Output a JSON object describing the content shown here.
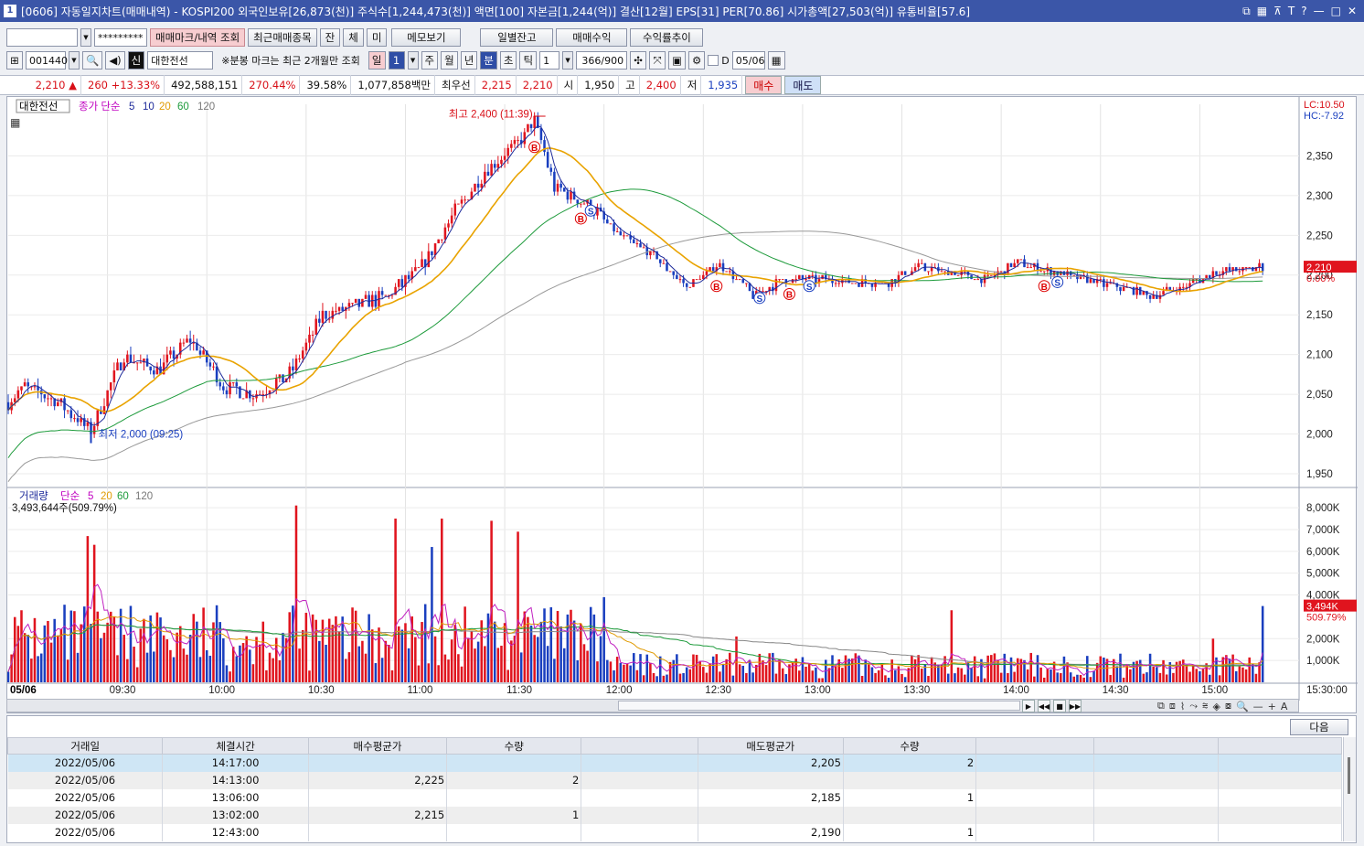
{
  "window": {
    "number": "1",
    "title": "[0606] 자동일지차트(매매내역) - KOSPI200 외국인보유[26,873(천)] 주식수[1,244,473(천)] 액면[100] 자본금[1,244(억)] 결산[12월] EPS[31] PER[70.86] 시가총액[27,503(억)] 유통비율[57.6]",
    "icons": [
      "restore-layout-icon",
      "window-grid-icon",
      "pin-icon",
      "text-icon",
      "help-icon",
      "minimize-icon",
      "maximize-icon",
      "close-icon"
    ]
  },
  "toolbar1": {
    "account_value": "",
    "password_value": "*********",
    "buttons": [
      "매매마크/내역 조회",
      "최근매매종목",
      "잔",
      "체",
      "미",
      "메모보기",
      "일별잔고",
      "매매수익",
      "수익률추이"
    ]
  },
  "toolbar2": {
    "code": "001440",
    "badge": "신",
    "stock_name": "대한전선",
    "notice": "※분봉 마크는 최근 2개월만 조회",
    "period_tabs": [
      "일",
      "1",
      "주",
      "월",
      "년",
      "분",
      "초",
      "틱"
    ],
    "interval": "1",
    "count": "366/900",
    "d_label": "D",
    "date": "05/06"
  },
  "quote": {
    "price": "2,210",
    "change": "260",
    "change_pct": "+13.33%",
    "volume": "492,588,151",
    "volume_ratio": "270.44%",
    "turnover": "39.58%",
    "amount": "1,077,858백만",
    "best_label": "최우선",
    "best_ask": "2,215",
    "best_bid": "2,210",
    "open_label": "시",
    "open": "1,950",
    "high_label": "고",
    "high": "2,400",
    "low_label": "저",
    "low": "1,935",
    "buy": "매수",
    "sell": "매도"
  },
  "chart_data": {
    "type": "candlestick",
    "price_legend": {
      "name": "대한전선",
      "label": "종가 단순",
      "periods": [
        "5",
        "10",
        "20",
        "60",
        "120"
      ]
    },
    "volume_legend": {
      "name": "거래량",
      "label": "단순",
      "periods": [
        "5",
        "20",
        "60",
        "120"
      ],
      "summary": "3,493,644주(509.79%)"
    },
    "lc": "LC:10.50",
    "hc": "HC:-7.92",
    "high_annotation": "최고 2,400 (11:39)",
    "low_annotation": "최저 2,000 (09:25)",
    "price_ticks": [
      "2,350",
      "2,300",
      "2,250",
      "2,200",
      "2,150",
      "2,100",
      "2,050",
      "2,000",
      "1,950"
    ],
    "price_ylim": [
      1935,
      2415
    ],
    "current_price": "2,210",
    "current_pct": "0.00%",
    "volume_ticks": [
      "8,000K",
      "7,000K",
      "6,000K",
      "5,000K",
      "4,000K",
      "2,000K",
      "1,000K"
    ],
    "volume_current": "3,494K",
    "volume_pct": "509.79%",
    "x_labels": [
      "05/06",
      "09:30",
      "10:00",
      "10:30",
      "11:00",
      "11:30",
      "12:00",
      "12:30",
      "13:00",
      "13:30",
      "14:00",
      "14:30",
      "15:00",
      "15:30:00"
    ],
    "price_path_keypoints": [
      {
        "time": "09:00",
        "price": 2040
      },
      {
        "time": "09:05",
        "price": 2060
      },
      {
        "time": "09:15",
        "price": 2040
      },
      {
        "time": "09:25",
        "price": 2005
      },
      {
        "time": "09:35",
        "price": 2100
      },
      {
        "time": "09:45",
        "price": 2080
      },
      {
        "time": "09:55",
        "price": 2120
      },
      {
        "time": "10:05",
        "price": 2060
      },
      {
        "time": "10:15",
        "price": 2050
      },
      {
        "time": "10:25",
        "price": 2075
      },
      {
        "time": "10:35",
        "price": 2150
      },
      {
        "time": "10:45",
        "price": 2160
      },
      {
        "time": "10:55",
        "price": 2175
      },
      {
        "time": "11:05",
        "price": 2210
      },
      {
        "time": "11:15",
        "price": 2280
      },
      {
        "time": "11:25",
        "price": 2335
      },
      {
        "time": "11:35",
        "price": 2370
      },
      {
        "time": "11:39",
        "price": 2395
      },
      {
        "time": "11:45",
        "price": 2310
      },
      {
        "time": "11:55",
        "price": 2290
      },
      {
        "time": "12:05",
        "price": 2250
      },
      {
        "time": "12:15",
        "price": 2225
      },
      {
        "time": "12:25",
        "price": 2185
      },
      {
        "time": "12:35",
        "price": 2215
      },
      {
        "time": "12:45",
        "price": 2175
      },
      {
        "time": "12:55",
        "price": 2195
      },
      {
        "time": "13:05",
        "price": 2195
      },
      {
        "time": "13:25",
        "price": 2190
      },
      {
        "time": "13:35",
        "price": 2210
      },
      {
        "time": "13:55",
        "price": 2195
      },
      {
        "time": "14:05",
        "price": 2215
      },
      {
        "time": "14:15",
        "price": 2205
      },
      {
        "time": "14:30",
        "price": 2190
      },
      {
        "time": "14:45",
        "price": 2175
      },
      {
        "time": "14:55",
        "price": 2185
      },
      {
        "time": "15:05",
        "price": 2205
      },
      {
        "time": "15:19",
        "price": 2210
      }
    ],
    "trade_marks": [
      {
        "type": "B",
        "time": "11:39"
      },
      {
        "type": "B",
        "time": "11:53"
      },
      {
        "type": "S",
        "time": "11:56"
      },
      {
        "type": "B",
        "time": "12:34"
      },
      {
        "type": "S",
        "time": "12:47"
      },
      {
        "type": "B",
        "time": "12:56"
      },
      {
        "type": "S",
        "time": "13:02"
      },
      {
        "type": "B",
        "time": "14:13"
      },
      {
        "type": "S",
        "time": "14:17"
      }
    ],
    "series_colors": {
      "up": "#e0141e",
      "down": "#1a3fbf",
      "ma5": "#1d2a9a",
      "ma10": "#e9a300",
      "ma20": "#1c9a3a",
      "ma60": "#7a7a7a",
      "ma120": "#999999",
      "vol_ma5": "#c020c0",
      "vol_ma20": "#e09a00",
      "vol_ma60": "#1c9a3a",
      "vol_ma120": "#888888"
    }
  },
  "trades": {
    "next_button": "다음",
    "columns": [
      "거래일",
      "체결시간",
      "매수평균가",
      "수량",
      "",
      "매도평균가",
      "수량",
      "",
      "",
      ""
    ],
    "rows": [
      [
        "2022/05/06",
        "14:17:00",
        "",
        "",
        "",
        "2,205",
        "2",
        "",
        "",
        ""
      ],
      [
        "2022/05/06",
        "14:13:00",
        "2,225",
        "2",
        "",
        "",
        "",
        "",
        "",
        ""
      ],
      [
        "2022/05/06",
        "13:06:00",
        "",
        "",
        "",
        "2,185",
        "1",
        "",
        "",
        ""
      ],
      [
        "2022/05/06",
        "13:02:00",
        "2,215",
        "1",
        "",
        "",
        "",
        "",
        "",
        ""
      ],
      [
        "2022/05/06",
        "12:43:00",
        "",
        "",
        "",
        "2,190",
        "1",
        "",
        "",
        ""
      ]
    ]
  }
}
